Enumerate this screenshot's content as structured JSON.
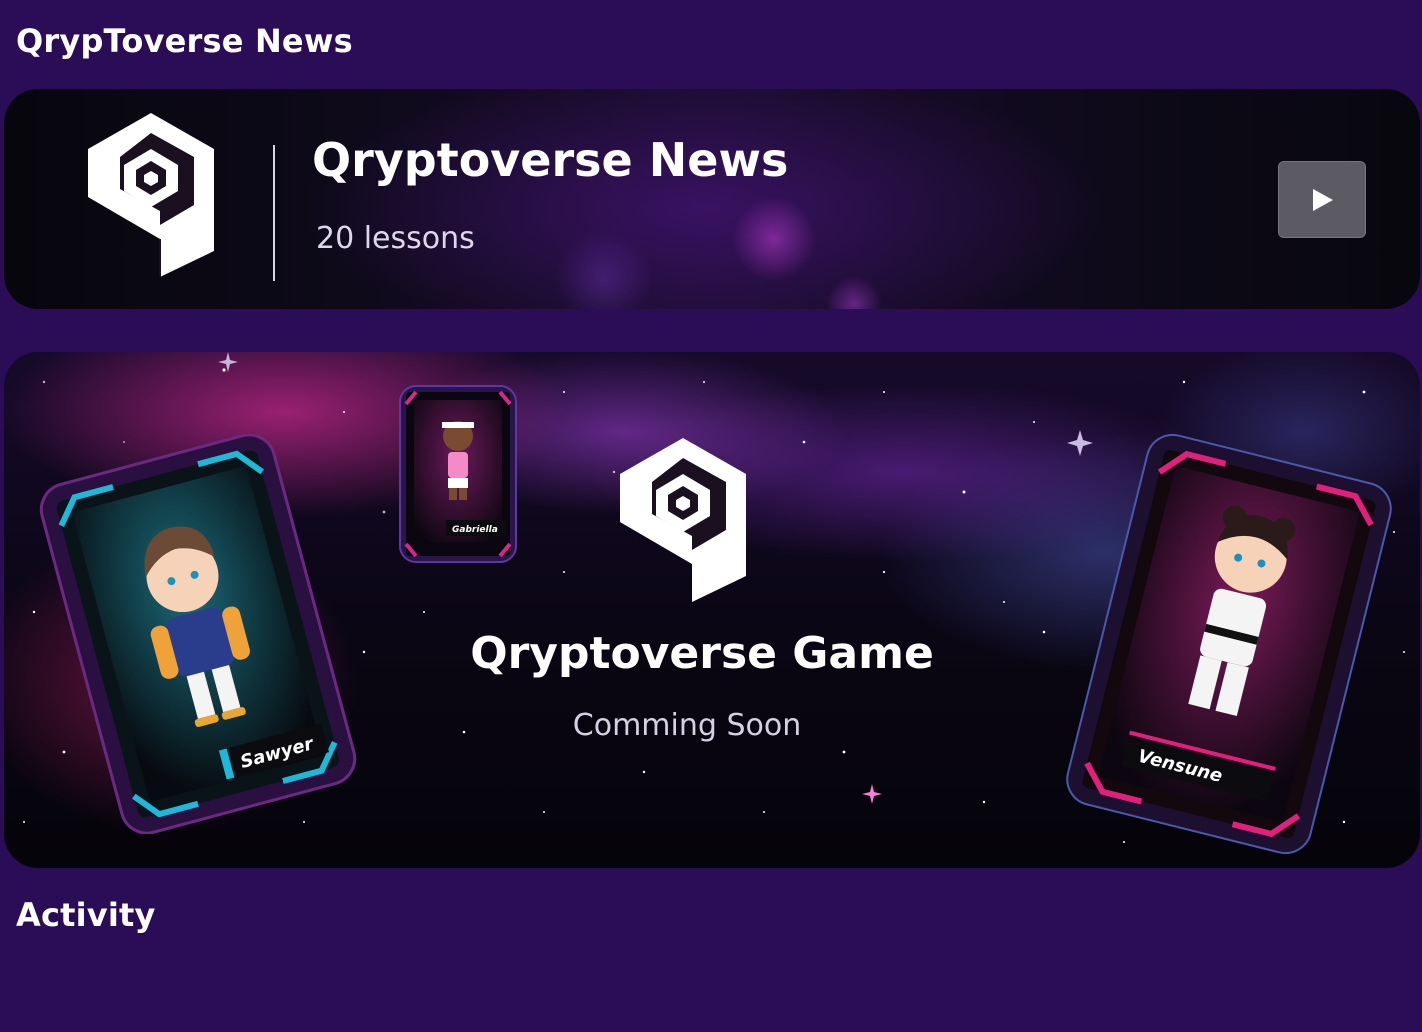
{
  "headings": {
    "news": "QrypToverse News",
    "activity": "Activity"
  },
  "news_card": {
    "title": "Qryptoverse News",
    "subtitle": "20 lessons",
    "play_icon": "play-icon",
    "logo_icon": "qryptoverse-logo"
  },
  "game_banner": {
    "title": "Qryptoverse Game",
    "subtitle": "Comming Soon",
    "logo_icon": "qryptoverse-logo",
    "cards": [
      {
        "name": "Sawyer",
        "accent": "#1fb8d8"
      },
      {
        "name": "Gabriella",
        "accent": "#d22a8a"
      },
      {
        "name": "Vensune",
        "accent": "#e0207a"
      }
    ]
  },
  "colors": {
    "background": "#2a0d56",
    "accent_pink": "#d22a8a",
    "accent_cyan": "#1fb8d8"
  }
}
